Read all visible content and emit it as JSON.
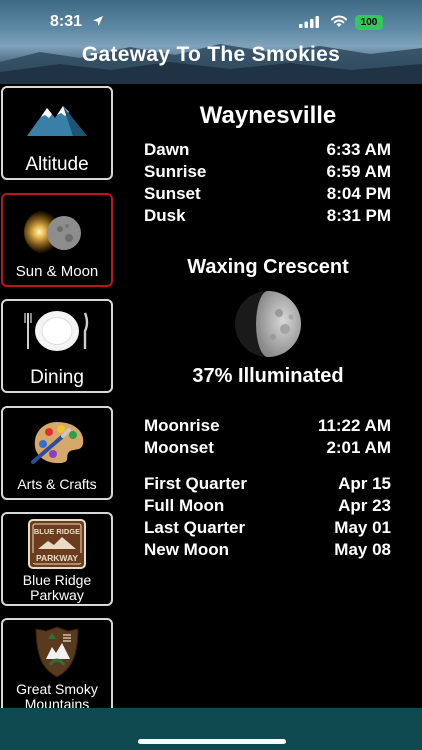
{
  "status_bar": {
    "time": "8:31",
    "battery": "100"
  },
  "header": {
    "title": "Gateway To The Smokies"
  },
  "sidebar": {
    "items": [
      {
        "label": "Altitude",
        "icon": "mountain-icon"
      },
      {
        "label": "Sun & Moon",
        "icon": "eclipse-icon",
        "selected": true
      },
      {
        "label": "Dining",
        "icon": "plate-icon"
      },
      {
        "label": "Arts & Crafts",
        "icon": "paint-palette-icon"
      },
      {
        "label": "Blue Ridge Parkway",
        "icon": "parkway-sign-icon",
        "sign_top": "BLUE RIDGE",
        "sign_bottom": "PARKWAY"
      },
      {
        "label": "Great Smoky Mountains",
        "icon": "park-service-icon"
      }
    ]
  },
  "main": {
    "city": "Waynesville",
    "sun_times": [
      {
        "label": "Dawn",
        "value": "6:33 AM"
      },
      {
        "label": "Sunrise",
        "value": "6:59 AM"
      },
      {
        "label": "Sunset",
        "value": "8:04 PM"
      },
      {
        "label": "Dusk",
        "value": "8:31 PM"
      }
    ],
    "moon_phase": "Waxing Crescent",
    "illumination": "37% Illuminated",
    "moon_times": [
      {
        "label": "Moonrise",
        "value": "11:22 AM"
      },
      {
        "label": "Moonset",
        "value": "2:01 AM"
      }
    ],
    "phase_dates": [
      {
        "label": "First Quarter",
        "value": "Apr 15"
      },
      {
        "label": "Full Moon",
        "value": "Apr 23"
      },
      {
        "label": "Last Quarter",
        "value": "May 01"
      },
      {
        "label": "New Moon",
        "value": "May 08"
      }
    ]
  },
  "colors": {
    "accent_selected": "#c0141d",
    "bottom_bar": "#0e4a4f",
    "battery": "#34c759"
  }
}
